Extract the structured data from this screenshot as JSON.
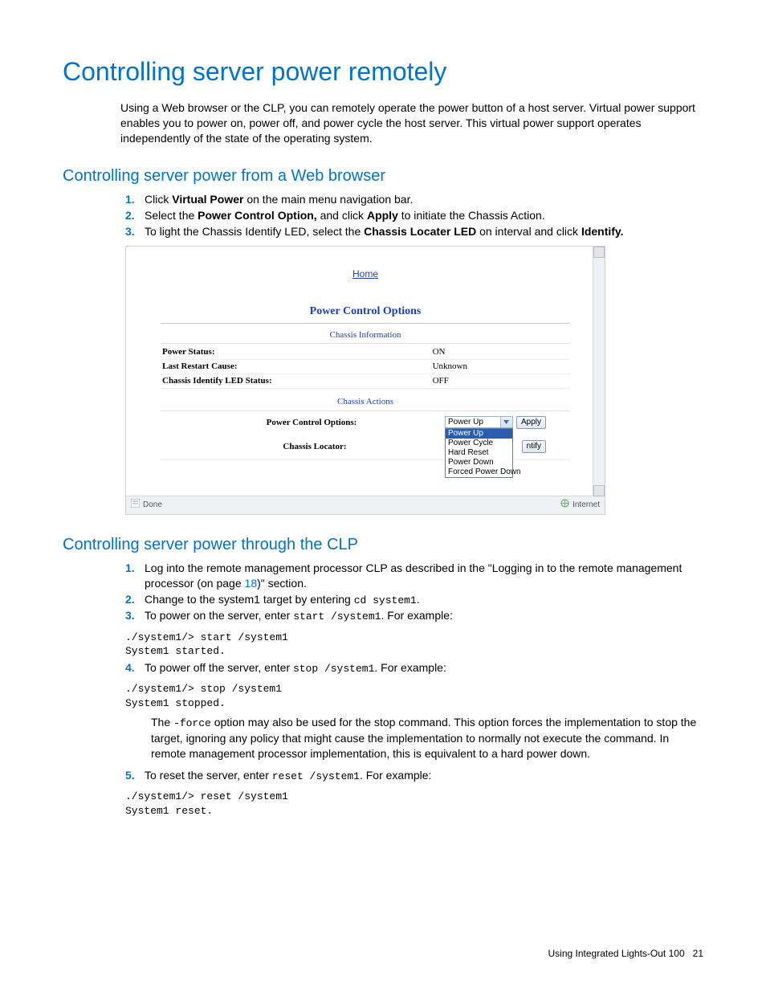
{
  "title": "Controlling server power remotely",
  "intro": "Using a Web browser or the CLP, you can remotely operate the power button of a host server. Virtual power support enables you to power on, power off, and power cycle the host server. This virtual power support operates independently of the state of the operating system.",
  "web": {
    "heading": "Controlling server power from a Web browser",
    "steps": {
      "s1": {
        "pre": "Click ",
        "b1": "Virtual Power",
        "post": " on the main menu navigation bar."
      },
      "s2": {
        "pre": "Select the ",
        "b1": "Power Control Option,",
        "mid": " and click ",
        "b2": "Apply",
        "post": " to initiate the Chassis Action."
      },
      "s3": {
        "pre": "To light the Chassis Identify LED, select the ",
        "b1": "Chassis Locater LED",
        "mid": " on interval and click ",
        "b2": "Identify."
      }
    }
  },
  "screenshot": {
    "home_link": "Home",
    "panel_title": "Power Control Options",
    "section_info": "Chassis Information",
    "info": {
      "r1": {
        "label": "Power Status:",
        "value": "ON"
      },
      "r2": {
        "label": "Last Restart Cause:",
        "value": "Unknown"
      },
      "r3": {
        "label": "Chassis Identify LED Status:",
        "value": "OFF"
      }
    },
    "section_actions": "Chassis Actions",
    "actions": {
      "pco_label": "Power Control Options:",
      "locator_label": "Chassis Locator:",
      "select_value": "Power Up",
      "options": [
        "Power Up",
        "Power Cycle",
        "Hard Reset",
        "Power Down",
        "Forced Power Down"
      ],
      "apply_btn": "Apply",
      "identify_btn": "ntify"
    },
    "status": {
      "left": "Done",
      "right": "Internet"
    }
  },
  "clp": {
    "heading": "Controlling server power through the CLP",
    "s1": {
      "pre": "Log into the remote management processor CLP as described in the \"Logging in to the remote management processor (on page ",
      "page": "18",
      "post": ")\" section."
    },
    "s2": {
      "pre": "Change to the system1 target by entering ",
      "code": "cd system1",
      "post": "."
    },
    "s3": {
      "pre": "To power on the server, enter ",
      "code": "start /system1",
      "post": ". For example:"
    },
    "block3": "./system1/> start /system1\nSystem1 started.",
    "s4": {
      "pre": "To power off the server, enter ",
      "code": "stop /system1",
      "post": ". For example:"
    },
    "block4": "./system1/> stop /system1\nSystem1 stopped.",
    "note": {
      "pre": "The ",
      "code": "-force",
      "post": " option may also be used for the stop command. This option forces the implementation to stop the target, ignoring any policy that might cause the implementation to normally not execute the command. In remote management processor implementation, this is equivalent to a hard power down."
    },
    "s5": {
      "pre": "To reset the server, enter ",
      "code": "reset /system1",
      "post": ". For example:"
    },
    "block5": "./system1/> reset /system1\nSystem1 reset."
  },
  "footer": {
    "text": "Using Integrated Lights-Out 100",
    "page": "21"
  }
}
